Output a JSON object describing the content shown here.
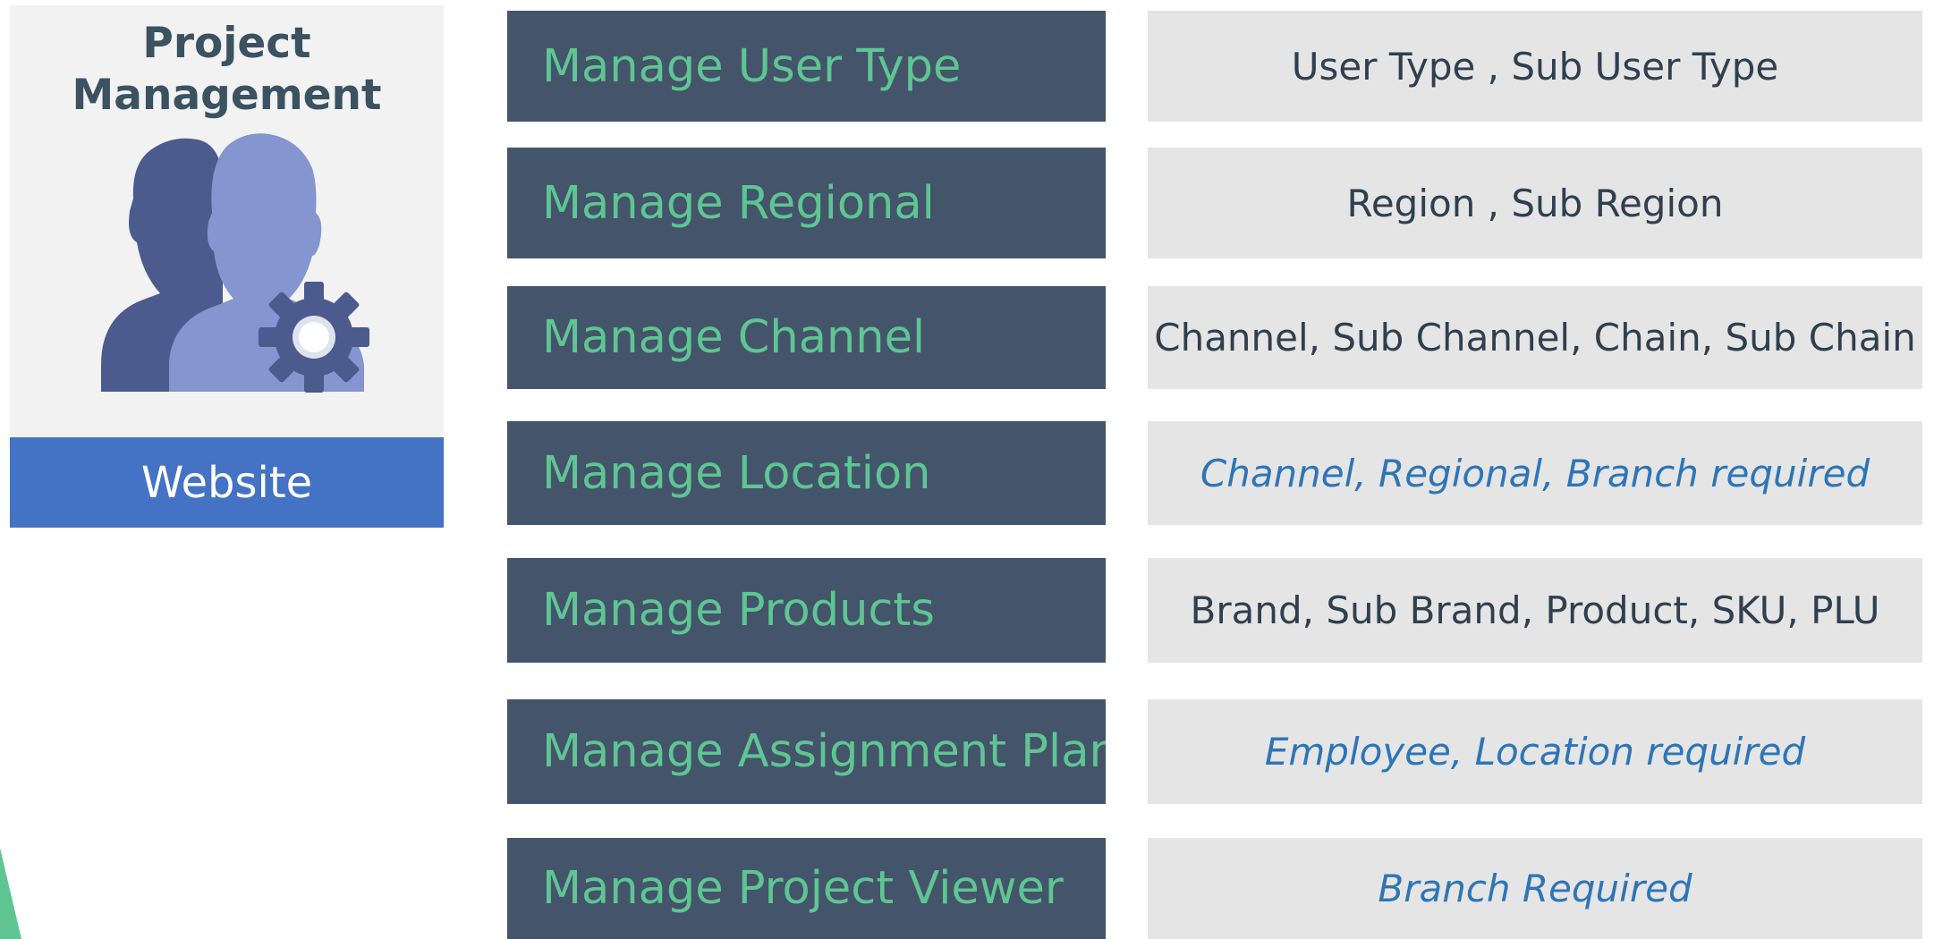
{
  "card": {
    "title_line1": "Project",
    "title_line2": "Management",
    "icon": "users-gear-icon",
    "footer_label": "Website"
  },
  "colors": {
    "label_bg": "#44546a",
    "label_text": "#5ec593",
    "desc_bg": "#e5e5e5",
    "desc_text": "#2f3f4f",
    "required_text": "#2e75b6",
    "card_footer_bg": "#4472c4",
    "card_title": "#3b5260",
    "accent_triangle": "#5ec593"
  },
  "rows": [
    {
      "label": "Manage User Type",
      "description": "User Type , Sub User Type",
      "required": false
    },
    {
      "label": "Manage Regional",
      "description": "Region , Sub Region",
      "required": false
    },
    {
      "label": "Manage Channel",
      "description": "Channel, Sub Channel, Chain, Sub Chain",
      "required": false
    },
    {
      "label": "Manage Location",
      "description": "Channel, Regional, Branch required",
      "required": true
    },
    {
      "label": "Manage Products",
      "description": "Brand, Sub Brand, Product, SKU, PLU",
      "required": false
    },
    {
      "label": "Manage Assignment Plan",
      "description": "Employee, Location required",
      "required": true
    },
    {
      "label": "Manage Project Viewer",
      "description": "Branch Required",
      "required": true
    }
  ]
}
